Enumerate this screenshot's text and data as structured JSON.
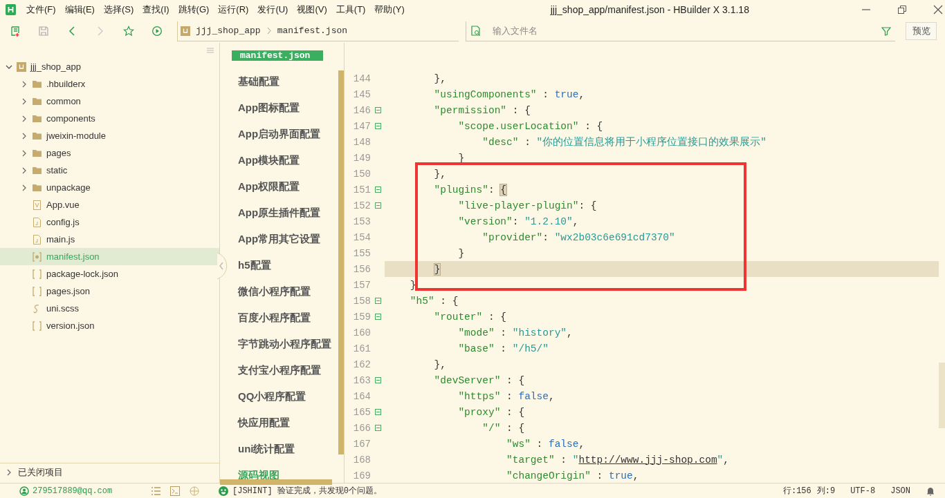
{
  "window": {
    "title": "jjj_shop_app/manifest.json - HBuilder X 3.1.18"
  },
  "menu": [
    "文件(F)",
    "编辑(E)",
    "选择(S)",
    "查找(I)",
    "跳转(G)",
    "运行(R)",
    "发行(U)",
    "视图(V)",
    "工具(T)",
    "帮助(Y)"
  ],
  "toolbar": {
    "breadcrumb": [
      "jjj_shop_app",
      "manifest.json"
    ],
    "search": {
      "placeholder": "输入文件名"
    },
    "preview_button": "预览"
  },
  "project_tree": {
    "name": "jjj_shop_app",
    "expanded": true,
    "children": [
      {
        "name": ".hbuilderx",
        "kind": "folder",
        "expanded": false,
        "selected": false
      },
      {
        "name": "common",
        "kind": "folder",
        "expanded": false,
        "selected": false
      },
      {
        "name": "components",
        "kind": "folder",
        "expanded": false,
        "selected": false
      },
      {
        "name": "jweixin-module",
        "kind": "folder",
        "expanded": false,
        "selected": false
      },
      {
        "name": "pages",
        "kind": "folder",
        "expanded": false,
        "selected": false
      },
      {
        "name": "static",
        "kind": "folder",
        "expanded": false,
        "selected": false
      },
      {
        "name": "unpackage",
        "kind": "folder",
        "expanded": false,
        "selected": false
      },
      {
        "name": "App.vue",
        "kind": "vue",
        "selected": false
      },
      {
        "name": "config.js",
        "kind": "js",
        "selected": false
      },
      {
        "name": "main.js",
        "kind": "js",
        "selected": false
      },
      {
        "name": "manifest.json",
        "kind": "manifest",
        "selected": true
      },
      {
        "name": "package-lock.json",
        "kind": "json",
        "selected": false
      },
      {
        "name": "pages.json",
        "kind": "json",
        "selected": false
      },
      {
        "name": "uni.scss",
        "kind": "scss",
        "selected": false
      },
      {
        "name": "version.json",
        "kind": "json",
        "selected": false
      }
    ]
  },
  "closed_projects": {
    "label": "已关闭项目",
    "expanded": false
  },
  "settings_nav": {
    "tab": "manifest.json",
    "items": [
      {
        "label": "基础配置",
        "selected": false
      },
      {
        "label": "App图标配置",
        "selected": false
      },
      {
        "label": "App启动界面配置",
        "selected": false
      },
      {
        "label": "App模块配置",
        "selected": false
      },
      {
        "label": "App权限配置",
        "selected": false
      },
      {
        "label": "App原生插件配置",
        "selected": false
      },
      {
        "label": "App常用其它设置",
        "selected": false
      },
      {
        "label": "h5配置",
        "selected": false
      },
      {
        "label": "微信小程序配置",
        "selected": false
      },
      {
        "label": "百度小程序配置",
        "selected": false
      },
      {
        "label": "字节跳动小程序配置",
        "selected": false
      },
      {
        "label": "支付宝小程序配置",
        "selected": false
      },
      {
        "label": "QQ小程序配置",
        "selected": false
      },
      {
        "label": "快应用配置",
        "selected": false
      },
      {
        "label": "uni统计配置",
        "selected": false
      },
      {
        "label": "源码视图",
        "selected": true
      }
    ]
  },
  "editor": {
    "highlight": {
      "kind": "rectangle"
    },
    "lines": [
      {
        "num": "144",
        "fold": false,
        "current": false,
        "tokens": [
          {
            "kind": "punctuation",
            "t": "        },"
          }
        ]
      },
      {
        "num": "145",
        "fold": false,
        "current": false,
        "tokens": [
          {
            "kind": "key",
            "t": "        \"usingComponents\""
          },
          {
            "kind": "punctuation",
            "t": " : "
          },
          {
            "kind": "keyword",
            "t": "true"
          },
          {
            "kind": "punctuation",
            "t": ","
          }
        ]
      },
      {
        "num": "146",
        "fold": true,
        "current": false,
        "tokens": [
          {
            "kind": "key",
            "t": "        \"permission\""
          },
          {
            "kind": "punctuation",
            "t": " : {"
          }
        ]
      },
      {
        "num": "147",
        "fold": true,
        "current": false,
        "tokens": [
          {
            "kind": "key",
            "t": "            \"scope.userLocation\""
          },
          {
            "kind": "punctuation",
            "t": " : {"
          }
        ]
      },
      {
        "num": "148",
        "fold": false,
        "current": false,
        "tokens": [
          {
            "kind": "key",
            "t": "                \"desc\""
          },
          {
            "kind": "punctuation",
            "t": " : "
          },
          {
            "kind": "string",
            "t": "\"你的位置信息将用于小程序位置接口的效果展示\""
          }
        ]
      },
      {
        "num": "149",
        "fold": false,
        "current": false,
        "tokens": [
          {
            "kind": "punctuation",
            "t": "            }"
          }
        ]
      },
      {
        "num": "150",
        "fold": false,
        "current": false,
        "tokens": [
          {
            "kind": "punctuation",
            "t": "        },"
          }
        ]
      },
      {
        "num": "151",
        "fold": true,
        "current": false,
        "tokens": [
          {
            "kind": "key",
            "t": "        \"plugins\""
          },
          {
            "kind": "punctuation",
            "t": ": "
          },
          {
            "kind": "bracket",
            "t": "{"
          }
        ]
      },
      {
        "num": "152",
        "fold": true,
        "current": false,
        "tokens": [
          {
            "kind": "key",
            "t": "            \"live-player-plugin\""
          },
          {
            "kind": "punctuation",
            "t": ": {"
          }
        ]
      },
      {
        "num": "153",
        "fold": false,
        "current": false,
        "tokens": [
          {
            "kind": "key",
            "t": "            \"version\""
          },
          {
            "kind": "punctuation",
            "t": ": "
          },
          {
            "kind": "string",
            "t": "\"1.2.10\""
          },
          {
            "kind": "punctuation",
            "t": ","
          }
        ]
      },
      {
        "num": "154",
        "fold": false,
        "current": false,
        "tokens": [
          {
            "kind": "key",
            "t": "                \"provider\""
          },
          {
            "kind": "punctuation",
            "t": ": "
          },
          {
            "kind": "string",
            "t": "\"wx2b03c6e691cd7370\""
          }
        ]
      },
      {
        "num": "155",
        "fold": false,
        "current": false,
        "tokens": [
          {
            "kind": "punctuation",
            "t": "            }"
          }
        ]
      },
      {
        "num": "156",
        "fold": false,
        "current": true,
        "tokens": [
          {
            "kind": "bracket",
            "t": "        }"
          }
        ]
      },
      {
        "num": "157",
        "fold": false,
        "current": false,
        "tokens": [
          {
            "kind": "punctuation",
            "t": "    }"
          }
        ]
      },
      {
        "num": "158",
        "fold": true,
        "current": false,
        "tokens": [
          {
            "kind": "key",
            "t": "    \"h5\""
          },
          {
            "kind": "punctuation",
            "t": " : {"
          }
        ]
      },
      {
        "num": "159",
        "fold": true,
        "current": false,
        "tokens": [
          {
            "kind": "key",
            "t": "        \"router\""
          },
          {
            "kind": "punctuation",
            "t": " : {"
          }
        ]
      },
      {
        "num": "160",
        "fold": false,
        "current": false,
        "tokens": [
          {
            "kind": "key",
            "t": "            \"mode\""
          },
          {
            "kind": "punctuation",
            "t": " : "
          },
          {
            "kind": "string",
            "t": "\"history\""
          },
          {
            "kind": "punctuation",
            "t": ","
          }
        ]
      },
      {
        "num": "161",
        "fold": false,
        "current": false,
        "tokens": [
          {
            "kind": "key",
            "t": "            \"base\""
          },
          {
            "kind": "punctuation",
            "t": " : "
          },
          {
            "kind": "string",
            "t": "\"/h5/\""
          }
        ]
      },
      {
        "num": "162",
        "fold": false,
        "current": false,
        "tokens": [
          {
            "kind": "punctuation",
            "t": "        },"
          }
        ]
      },
      {
        "num": "163",
        "fold": true,
        "current": false,
        "tokens": [
          {
            "kind": "key",
            "t": "        \"devServer\""
          },
          {
            "kind": "punctuation",
            "t": " : {"
          }
        ]
      },
      {
        "num": "164",
        "fold": false,
        "current": false,
        "tokens": [
          {
            "kind": "key",
            "t": "            \"https\""
          },
          {
            "kind": "punctuation",
            "t": " : "
          },
          {
            "kind": "keyword",
            "t": "false"
          },
          {
            "kind": "punctuation",
            "t": ","
          }
        ]
      },
      {
        "num": "165",
        "fold": true,
        "current": false,
        "tokens": [
          {
            "kind": "key",
            "t": "            \"proxy\""
          },
          {
            "kind": "punctuation",
            "t": " : {"
          }
        ]
      },
      {
        "num": "166",
        "fold": true,
        "current": false,
        "tokens": [
          {
            "kind": "key",
            "t": "                \"/\""
          },
          {
            "kind": "punctuation",
            "t": " : {"
          }
        ]
      },
      {
        "num": "167",
        "fold": false,
        "current": false,
        "tokens": [
          {
            "kind": "key",
            "t": "                    \"ws\""
          },
          {
            "kind": "punctuation",
            "t": " : "
          },
          {
            "kind": "keyword",
            "t": "false"
          },
          {
            "kind": "punctuation",
            "t": ","
          }
        ]
      },
      {
        "num": "168",
        "fold": false,
        "current": false,
        "tokens": [
          {
            "kind": "key",
            "t": "                    \"target\""
          },
          {
            "kind": "punctuation",
            "t": " : "
          },
          {
            "kind": "string",
            "t": "\""
          },
          {
            "kind": "link",
            "t": "http://www.jjj-shop.com"
          },
          {
            "kind": "string",
            "t": "\""
          },
          {
            "kind": "punctuation",
            "t": ","
          }
        ]
      },
      {
        "num": "169",
        "fold": false,
        "current": false,
        "tokens": [
          {
            "kind": "key",
            "t": "                    \"changeOrigin\""
          },
          {
            "kind": "punctuation",
            "t": " : "
          },
          {
            "kind": "keyword",
            "t": "true"
          },
          {
            "kind": "punctuation",
            "t": ","
          }
        ]
      }
    ]
  },
  "status_bar": {
    "user": "279517889@qq.com",
    "message": "[JSHINT] 验证完成，共发现0个问题。",
    "line": "行:156",
    "column": "列:9",
    "encoding": "UTF-8",
    "language": "JSON"
  }
}
